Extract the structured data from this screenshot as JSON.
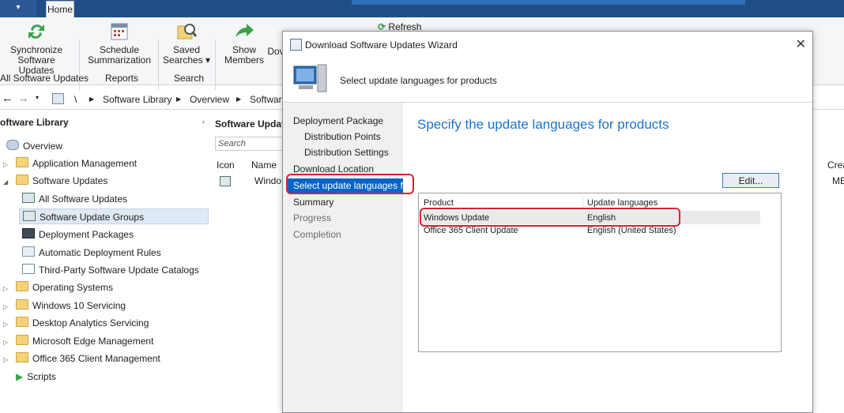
{
  "ribbon": {
    "tab_home": "Home",
    "buttons": {
      "sync": "Synchronize\nSoftware Updates",
      "schedule": "Schedule\nSummarization",
      "saved": "Saved\nSearches ▾",
      "show_members": "Show\nMembers",
      "dow": "Dov",
      "refresh": "Refresh"
    },
    "groups": [
      "All Software Updates",
      "Reports",
      "Search"
    ]
  },
  "breadcrumb": [
    "\\",
    "Software Library",
    "Overview",
    "Software"
  ],
  "nav": {
    "header": "oftware Library",
    "items": [
      {
        "label": "Overview",
        "level": 1,
        "expander": ""
      },
      {
        "label": "Application Management",
        "level": 0,
        "expander": "▷"
      },
      {
        "label": "Software Updates",
        "level": 0,
        "expander": "◢"
      },
      {
        "label": "All Software Updates",
        "level": 1,
        "expander": ""
      },
      {
        "label": "Software Update Groups",
        "level": 1,
        "expander": "",
        "selected": true
      },
      {
        "label": "Deployment Packages",
        "level": 1,
        "expander": ""
      },
      {
        "label": "Automatic Deployment Rules",
        "level": 1,
        "expander": ""
      },
      {
        "label": "Third-Party Software Update Catalogs",
        "level": 1,
        "expander": ""
      },
      {
        "label": "Operating Systems",
        "level": 0,
        "expander": "▷"
      },
      {
        "label": "Windows 10 Servicing",
        "level": 0,
        "expander": "▷"
      },
      {
        "label": "Desktop Analytics Servicing",
        "level": 0,
        "expander": "▷"
      },
      {
        "label": "Microsoft Edge Management",
        "level": 0,
        "expander": "▷"
      },
      {
        "label": "Office 365 Client Management",
        "level": 0,
        "expander": "▷"
      },
      {
        "label": "Scripts",
        "level": 0,
        "expander": ""
      }
    ]
  },
  "center": {
    "title": "Software Update",
    "search_placeholder": "Search",
    "col_icon": "Icon",
    "col_name": "Name",
    "row_name": "Windo",
    "col_right": "Crea",
    "row_right": "ME"
  },
  "dialog": {
    "title": "Download Software Updates Wizard",
    "close": "✕",
    "header": "Select update languages for products",
    "steps": [
      {
        "label": "Deployment Package",
        "indent": false,
        "state": "done"
      },
      {
        "label": "Distribution Points",
        "indent": true,
        "state": "done"
      },
      {
        "label": "Distribution Settings",
        "indent": true,
        "state": "done"
      },
      {
        "label": "Download Location",
        "indent": false,
        "state": "done"
      },
      {
        "label": "Select update languages for",
        "indent": false,
        "state": "active"
      },
      {
        "label": "Summary",
        "indent": false,
        "state": "done"
      },
      {
        "label": "Progress",
        "indent": false,
        "state": "pending"
      },
      {
        "label": "Completion",
        "indent": false,
        "state": "pending"
      }
    ],
    "content_title": "Specify the update languages for products",
    "edit_button": "Edit...",
    "table": {
      "headers": [
        "Product",
        "Update languages"
      ],
      "rows": [
        [
          "Windows Update",
          "English"
        ],
        [
          "Office 365 Client Update",
          "English (United States)"
        ]
      ]
    }
  },
  "colors": {
    "accent": "#0a64c8",
    "highlight": "#d9232e",
    "title_blue": "#1e73c8"
  }
}
